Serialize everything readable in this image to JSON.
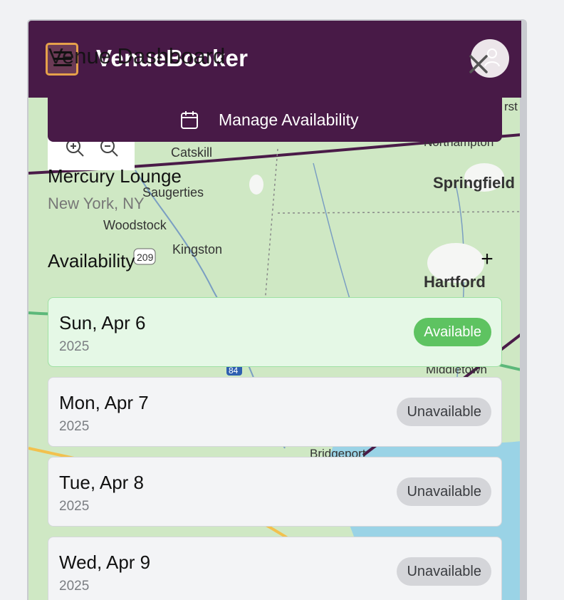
{
  "header": {
    "app_title": "VenueBooker",
    "ghost_title": "Venue Dashboard",
    "menu_icon": "hamburger-icon",
    "close_icon": "close-icon",
    "avatar_icon": "user-icon"
  },
  "manage": {
    "label": "Manage Availability",
    "icon": "calendar-icon"
  },
  "map": {
    "labels": [
      "Catskill",
      "Saugerties",
      "Woodstock",
      "Kingston",
      "Springfield",
      "Hartford",
      "Northampton",
      "Middletown",
      "Bridgeport",
      "rst",
      "209",
      "84"
    ]
  },
  "venue": {
    "name": "Mercury Lounge",
    "location": "New York, NY"
  },
  "availability": {
    "heading": "Availability",
    "add_label": "+",
    "days": [
      {
        "date": "Sun, Apr 6",
        "year": "2025",
        "status": "Available"
      },
      {
        "date": "Mon, Apr 7",
        "year": "2025",
        "status": "Unavailable"
      },
      {
        "date": "Tue, Apr 8",
        "year": "2025",
        "status": "Unavailable"
      },
      {
        "date": "Wed, Apr 9",
        "year": "2025",
        "status": "Unavailable"
      }
    ]
  },
  "colors": {
    "header": "#481a47",
    "available_badge": "#5ec361",
    "unavailable_badge": "#d4d5d9",
    "accent": "#e6a14a"
  }
}
